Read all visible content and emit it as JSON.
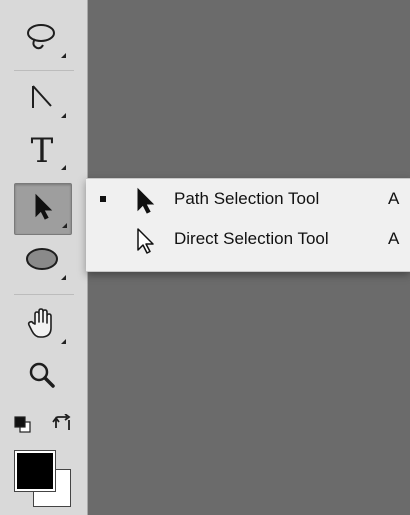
{
  "toolbar": {
    "tools": [
      {
        "icon": "lasso-icon"
      },
      {
        "icon": "pen-icon"
      },
      {
        "icon": "type-icon",
        "glyph": "T"
      },
      {
        "icon": "path-selection-icon",
        "active": true
      },
      {
        "icon": "ellipse-icon"
      },
      {
        "icon": "hand-icon"
      },
      {
        "icon": "zoom-icon"
      }
    ],
    "colors": {
      "foreground": "#000000",
      "background": "#ffffff"
    }
  },
  "flyout": {
    "items": [
      {
        "label": "Path Selection Tool",
        "shortcut": "A",
        "selected": true,
        "icon": "filled-arrow-icon"
      },
      {
        "label": "Direct Selection Tool",
        "shortcut": "A",
        "selected": false,
        "icon": "hollow-arrow-icon"
      }
    ]
  }
}
